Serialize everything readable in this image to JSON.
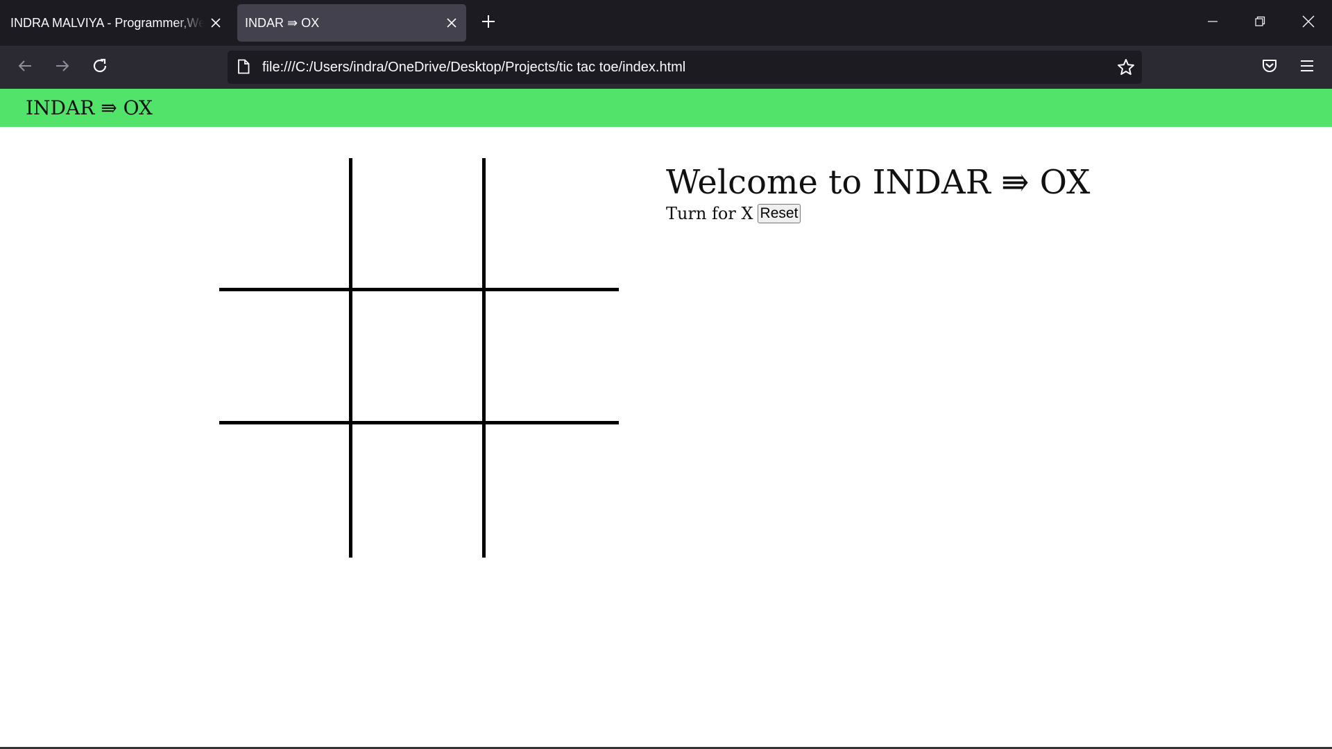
{
  "browser": {
    "tabs": [
      {
        "title": "INDRA MALVIYA - Programmer,Web Developer",
        "active": false
      },
      {
        "title": "INDAR ⇛ OX",
        "active": true
      }
    ],
    "url": "file:///C:/Users/indra/OneDrive/Desktop/Projects/tic tac toe/index.html",
    "colors": {
      "tabbar": "#1c1b22",
      "active_tab": "#42414d",
      "navbar": "#2b2a33",
      "urlbar": "#1c1b22"
    },
    "icons": [
      "close-icon",
      "plus-icon",
      "minimize-icon",
      "restore-icon",
      "back-arrow-icon",
      "forward-arrow-icon",
      "reload-icon",
      "page-icon",
      "star-icon",
      "pocket-icon",
      "menu-icon"
    ]
  },
  "page": {
    "header": {
      "title": "INDAR ⇛ OX",
      "color": "#52e36b"
    },
    "welcome": "Welcome to INDAR ⇛ OX",
    "turn_text": "Turn for X",
    "reset_label": "Reset",
    "board": [
      "",
      "",
      "",
      "",
      "",
      "",
      "",
      "",
      ""
    ]
  }
}
